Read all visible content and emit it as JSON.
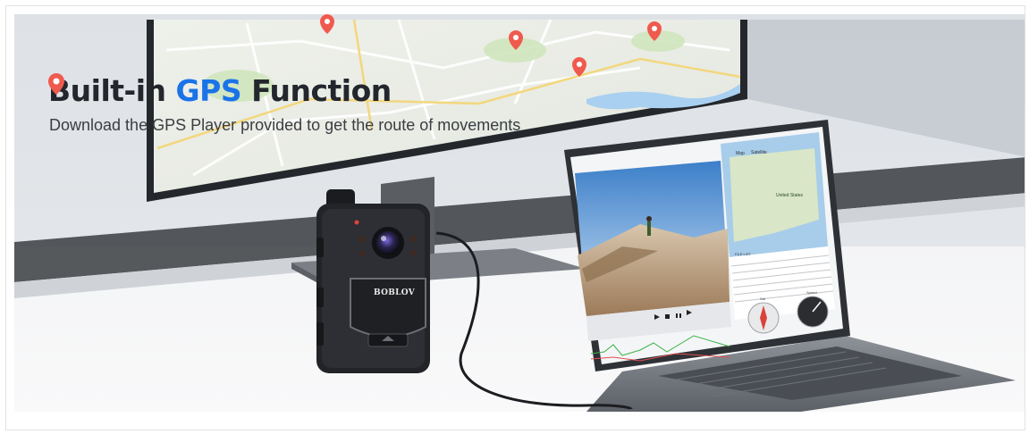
{
  "banner": {
    "headline_prefix": "Built-in ",
    "headline_accent": "GPS",
    "headline_suffix": " Function",
    "subtitle": "Download the GPS Player provided to get the route of movements"
  },
  "device": {
    "brand": "BOBLOV"
  },
  "gps_player": {
    "map_tab": "Map",
    "satellite_tab": "Satellite",
    "map_region_label": "United States",
    "file_list_label": "FILE LIST",
    "compass_label": "Sat",
    "speed_label": "Speed"
  },
  "colors": {
    "accent": "#1a73e8",
    "pin": "#f05a4e",
    "headline": "#23272d"
  }
}
